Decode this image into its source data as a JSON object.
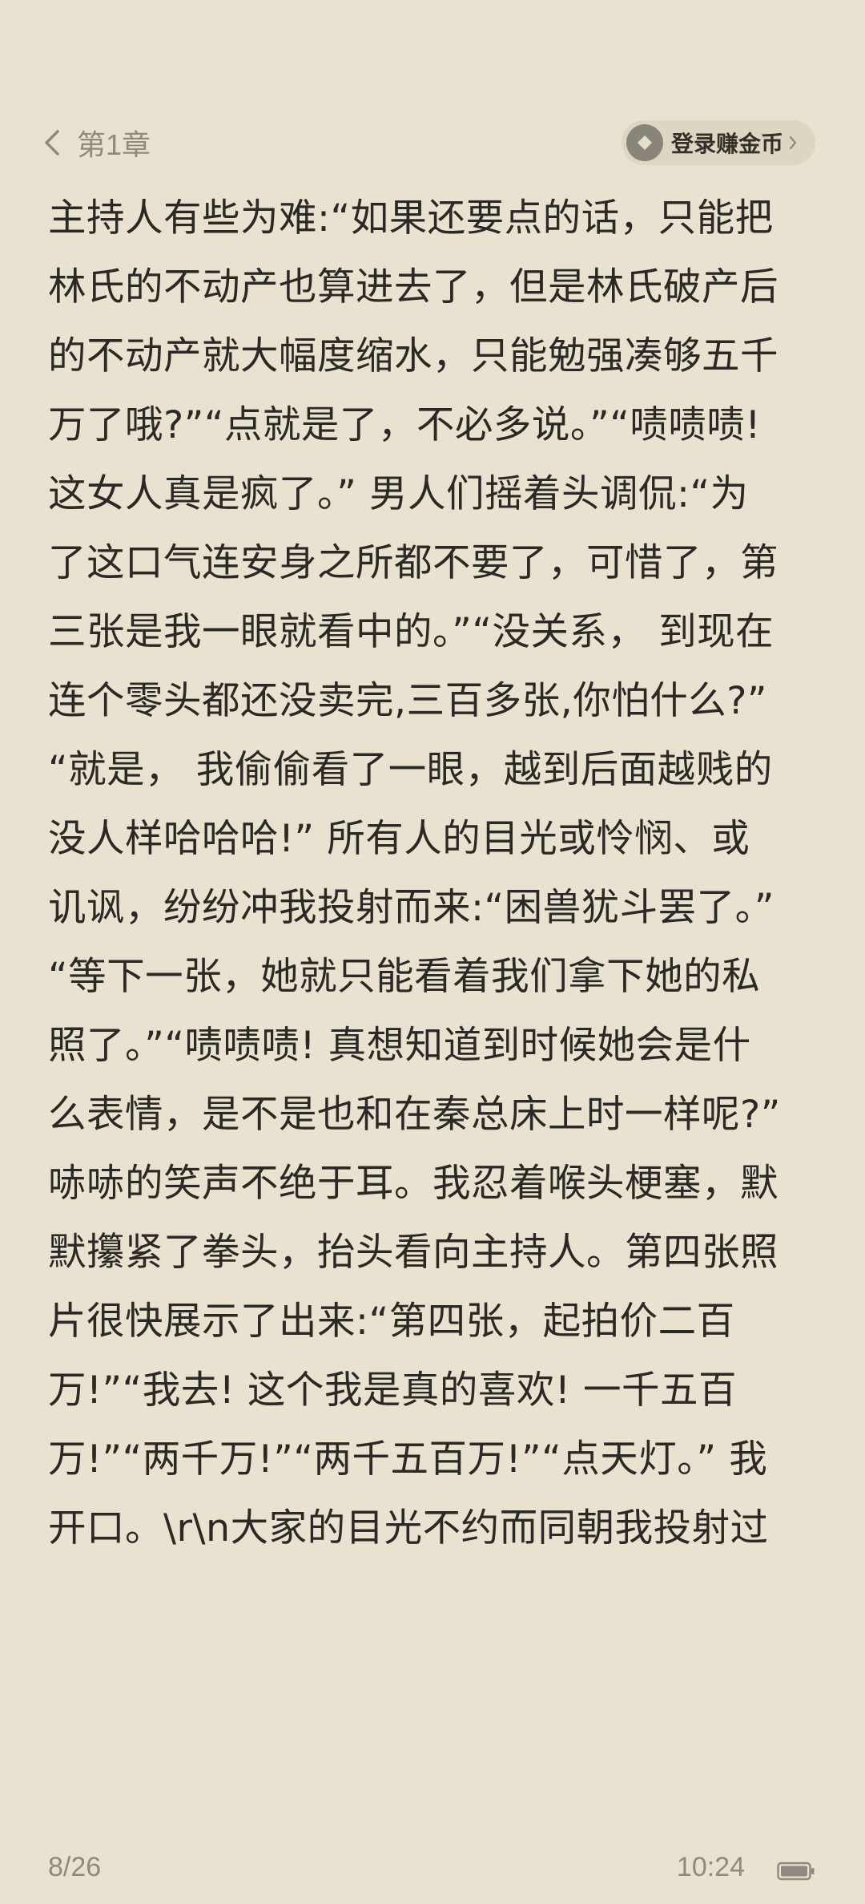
{
  "header": {
    "chapter_title": "第1章",
    "coin_button_label": "登录赚金币"
  },
  "content": {
    "lines": [
      "主持人有些为难:“如果还要点的话，只能把",
      "林氏的不动产也算进去了，但是林氏破产后",
      "的不动产就大幅度缩水，只能勉强凑够五千",
      "万了哦?”“点就是了，不必多说。”“啧啧啧!",
      "这女人真是疯了。” 男人们摇着头调侃:“为",
      "了这口气连安身之所都不要了，可惜了，第",
      "三张是我一眼就看中的。”“没关系， 到现在",
      "连个零头都还没卖完,三百多张,你怕什么?”",
      "“就是， 我偷偷看了一眼，越到后面越贱的",
      "没人样哈哈哈!” 所有人的目光或怜悯、或",
      "讥讽，纷纷冲我投射而来:“困兽犹斗罢了。”",
      "“等下一张，她就只能看着我们拿下她的私",
      "照了。”“啧啧啧! 真想知道到时候她会是什",
      "么表情，是不是也和在秦总床上时一样呢?”",
      "哧哧的笑声不绝于耳。我忍着喉头梗塞，默",
      "默攥紧了拳头，抬头看向主持人。第四张照",
      "片很快展示了出来:“第四张，起拍价二百",
      "万!”“我去! 这个我是真的喜欢! 一千五百",
      "万!”“两千万!”“两千五百万!”“点天灯。” 我",
      "开口。\\r\\n大家的目光不约而同朝我投射过"
    ]
  },
  "footer": {
    "page_indicator": "8/26",
    "time": "10:24"
  },
  "colors": {
    "background": "#e9e2d0",
    "text": "#2b2925",
    "muted": "#8f8a80",
    "pill": "#ddd6c3"
  }
}
